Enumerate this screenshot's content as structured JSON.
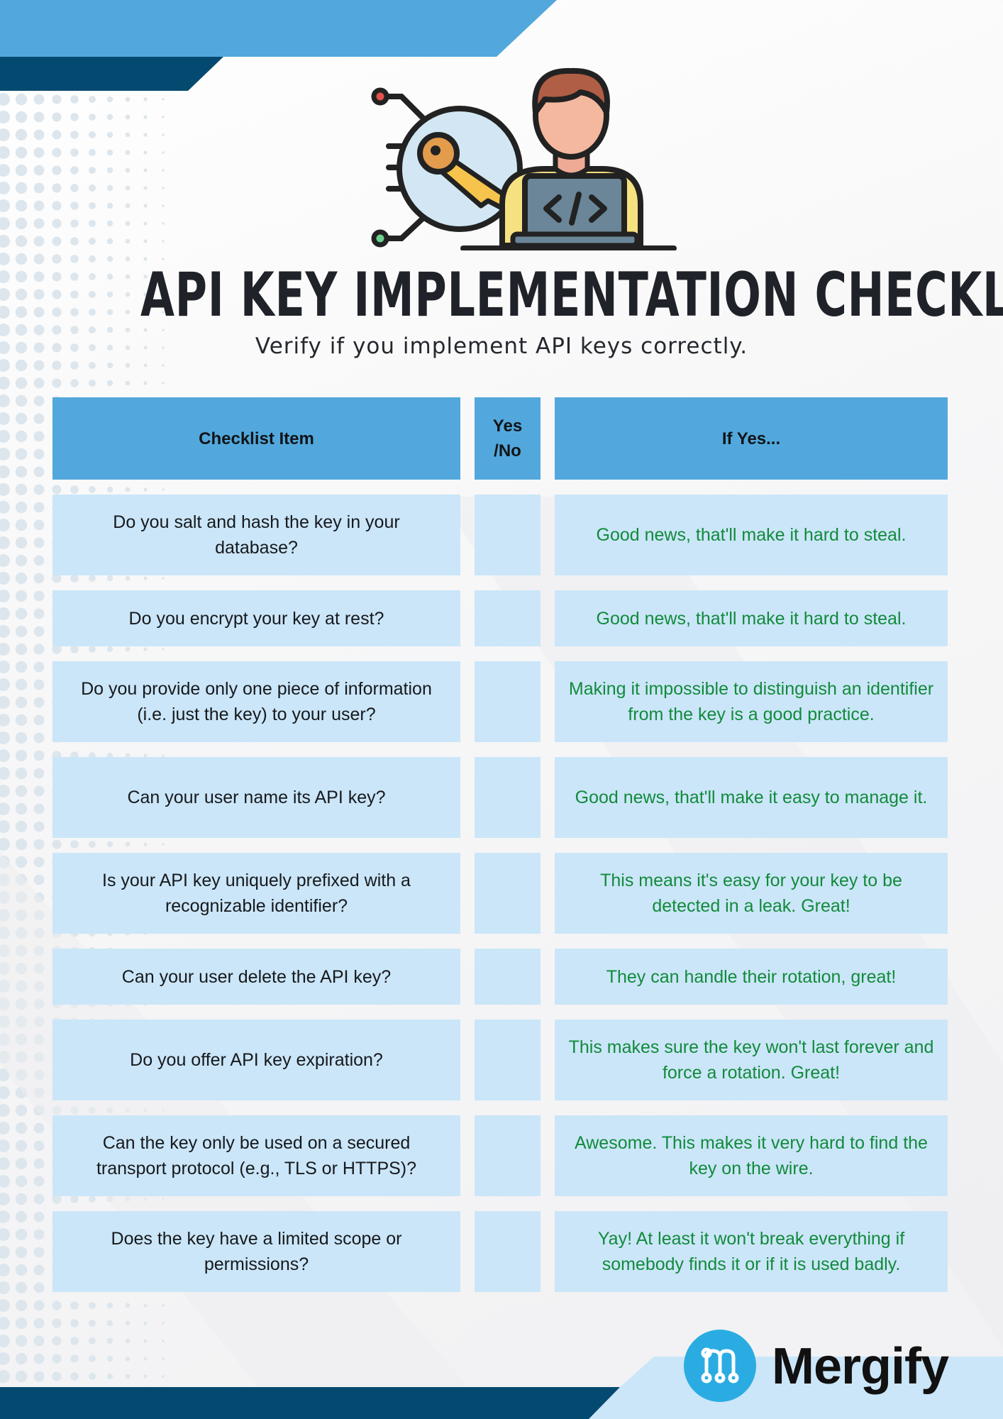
{
  "title": "API KEY IMPLEMENTATION CHECKLIST",
  "subtitle": "Verify if you implement API keys correctly.",
  "table": {
    "headers": {
      "item": "Checklist Item",
      "yes_no": "Yes /No",
      "if_yes": "If Yes..."
    },
    "rows": [
      {
        "item": "Do you salt and hash the key in your database?",
        "yes_no": "",
        "if_yes": "Good news, that'll make it hard to steal."
      },
      {
        "item": "Do you encrypt your key at rest?",
        "yes_no": "",
        "if_yes": "Good news, that'll make it hard to steal."
      },
      {
        "item": "Do you provide only one piece of information (i.e. just the key) to your user?",
        "yes_no": "",
        "if_yes": "Making it impossible to distinguish an identifier from the key is a good practice."
      },
      {
        "item": "Can your user name its API key?",
        "yes_no": "",
        "if_yes": "Good news, that'll make it easy to manage it."
      },
      {
        "item": "Is your API key uniquely prefixed with a recognizable identifier?",
        "yes_no": "",
        "if_yes": "This means it's easy for your key to be detected in a leak. Great!"
      },
      {
        "item": "Can your user delete the API key?",
        "yes_no": "",
        "if_yes": "They can handle their rotation, great!"
      },
      {
        "item": "Do you offer API key expiration?",
        "yes_no": "",
        "if_yes": "This makes sure the key won't last forever and force a rotation. Great!"
      },
      {
        "item": "Can the key only be used on a secured transport protocol (e.g., TLS or HTTPS)?",
        "yes_no": "",
        "if_yes": "Awesome. This makes it very hard to find the key on the wire."
      },
      {
        "item": "Does the key have a limited scope or permissions?",
        "yes_no": "",
        "if_yes": "Yay! At least it won't break everything if somebody finds it or if it is used badly."
      }
    ]
  },
  "footer": {
    "brand": "Mergify",
    "logo_icon": "mergify-logo-icon"
  },
  "illustration": {
    "icon": "developer-with-api-key-icon"
  },
  "colors": {
    "header_blue": "#52a8dc",
    "dark_navy": "#044a70",
    "cell_light_blue": "#cbe6f8",
    "answer_green": "#128a3c",
    "brand_blue": "#2aace2"
  }
}
